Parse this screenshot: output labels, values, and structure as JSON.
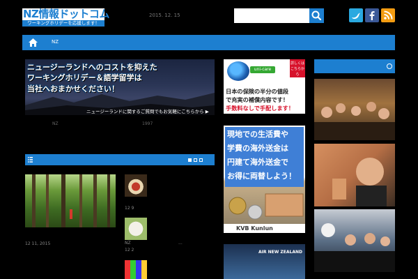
{
  "header": {
    "logo_title": "NZ情報ドットコム",
    "logo_subtitle": "ワーキングホリデーを応援します！",
    "date": "2015. 12. 15",
    "search_placeholder": ""
  },
  "nav": {
    "items": [
      {
        "label": "NZ"
      }
    ]
  },
  "hero": {
    "lines": [
      "ニュージーランドへのコストを抑えた",
      "ワーキングホリデー＆語学留学は",
      "当社へおまかせください！"
    ],
    "footer": "ニュージーランドに関するご質問でもお気軽にこちらから ▶"
  },
  "breadcrumbs": {
    "left": "NZ",
    "right": "1997"
  },
  "posts": {
    "featured_meta": "12  11, 2015",
    "side": [
      {
        "meta": "12   9"
      },
      {
        "label": "NZ",
        "ellipsis": "...",
        "meta": "12   2"
      }
    ]
  },
  "ads": {
    "unicare": {
      "brand": "uni-care",
      "tag": "詳しくはこちらから",
      "lines": [
        "日本の保険の半分の値段",
        "で充実の補償内容です！",
        "手数料なしで手配します！"
      ]
    },
    "kvb": {
      "lines": [
        "現地での生活費や",
        "学費の海外送金は",
        "円建て海外送金で",
        "お得に両替しよう！"
      ],
      "footer": "KVB Kunlun"
    },
    "airnz": {
      "text": "AIR NEW ZEALAND"
    }
  },
  "colors": {
    "accent": "#1d7fd0",
    "twitter": "#2aa9e0",
    "facebook": "#3b5998",
    "rss": "#f39c12"
  }
}
